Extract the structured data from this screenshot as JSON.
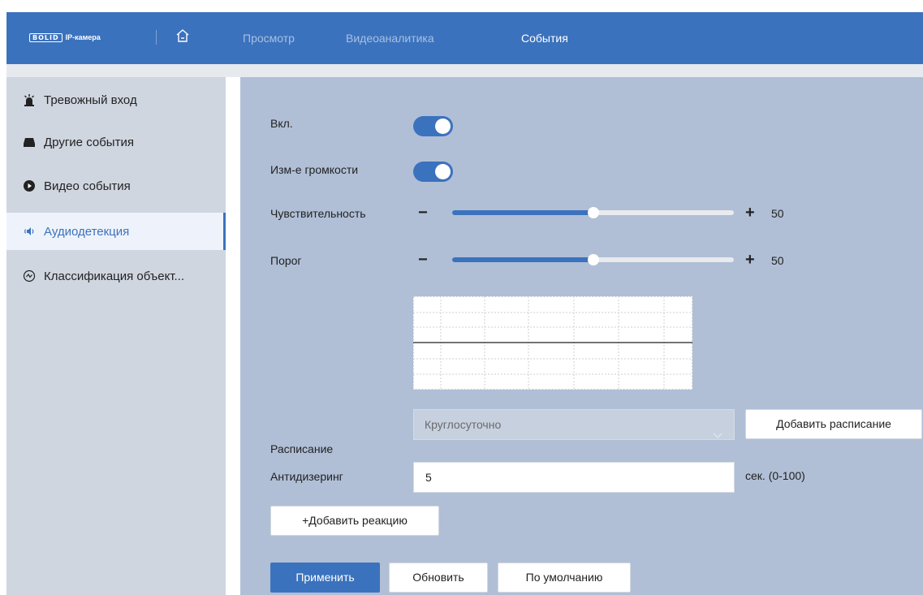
{
  "header": {
    "logo_mark": "BOLID",
    "logo_text": "IP-камера",
    "nav": [
      "Просмотр",
      "Видеоаналитика",
      "События"
    ],
    "active_nav": "События"
  },
  "sidebar": {
    "items": [
      {
        "label": "Тревожный вход",
        "icon": "alarm-light-icon"
      },
      {
        "label": "Другие события",
        "icon": "hdd-icon"
      },
      {
        "label": "Видео события",
        "icon": "video-play-icon"
      },
      {
        "label": "Аудиодетекция",
        "icon": "speaker-icon",
        "active": true
      },
      {
        "label": "Классификация объект...",
        "icon": "classification-icon"
      }
    ]
  },
  "form": {
    "enable_label": "Вкл.",
    "enable_on": true,
    "volume_change_label": "Изм-е громкости",
    "volume_change_on": true,
    "sensitivity_label": "Чувствительность",
    "sensitivity_value": "50",
    "sensitivity_level": 0.5,
    "threshold_label": "Порог",
    "threshold_value": "50",
    "threshold_level": 0.5,
    "minus": "−",
    "plus": "+",
    "schedule_label": "Расписание",
    "schedule_value": "Круглосуточно",
    "add_schedule_button": "Добавить расписание",
    "antidither_label": "Антидизеринг",
    "antidither_value": "5",
    "antidither_unit": "сек. (0-100)",
    "add_reaction_button": "+Добавить реакцию"
  },
  "actions": {
    "apply": "Применить",
    "refresh": "Обновить",
    "default": "По умолчанию"
  },
  "colors": {
    "accent": "#3b72bd",
    "content_bg": "#b0bfd6",
    "sidebar_bg": "#d0d6e0"
  }
}
